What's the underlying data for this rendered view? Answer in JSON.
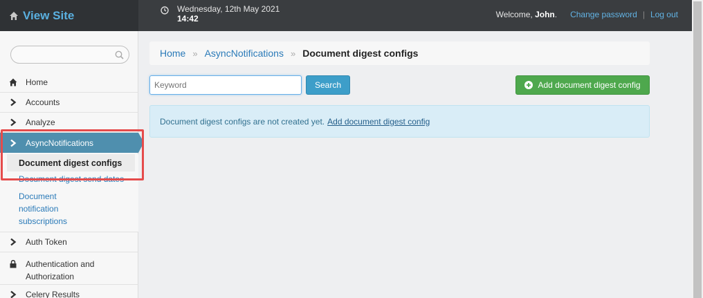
{
  "header": {
    "brand": "View Site",
    "date": "Wednesday, 12th May 2021",
    "time": "14:42",
    "welcome_prefix": "Welcome, ",
    "user_name": "John",
    "welcome_suffix": ".",
    "change_password": "Change password",
    "separator": "|",
    "logout": "Log out"
  },
  "sidebar": {
    "items": [
      {
        "label": "Home",
        "icon": "home-icon"
      },
      {
        "label": "Accounts",
        "icon": "chevron-right-icon"
      },
      {
        "label": "Analyze",
        "icon": "chevron-right-icon"
      },
      {
        "label": "AsyncNotifications",
        "icon": "chevron-right-icon"
      },
      {
        "label": "Auth Token",
        "icon": "chevron-right-icon"
      },
      {
        "label": "Authentication and Authorization",
        "icon": "lock-icon"
      },
      {
        "label": "Celery Results",
        "icon": "chevron-right-icon"
      }
    ],
    "subitems": [
      {
        "label": "Document digest configs"
      },
      {
        "label": "Document digest send dates"
      },
      {
        "label": "Document notification subscriptions"
      }
    ]
  },
  "breadcrumb": {
    "home": "Home",
    "sep": "»",
    "section": "AsyncNotifications",
    "current": "Document digest configs"
  },
  "search": {
    "placeholder": "Keyword",
    "button": "Search"
  },
  "add_button": "Add document digest config",
  "alert": {
    "text": "Document digest configs are not created yet.",
    "link": "Add document digest config"
  },
  "colors": {
    "header_bg": "#3a3d40",
    "brand": "#5ab0e0",
    "active_nav": "#4f8fae",
    "link": "#2a7ab8",
    "success": "#4ea84d",
    "highlight": "#e54b4b"
  }
}
